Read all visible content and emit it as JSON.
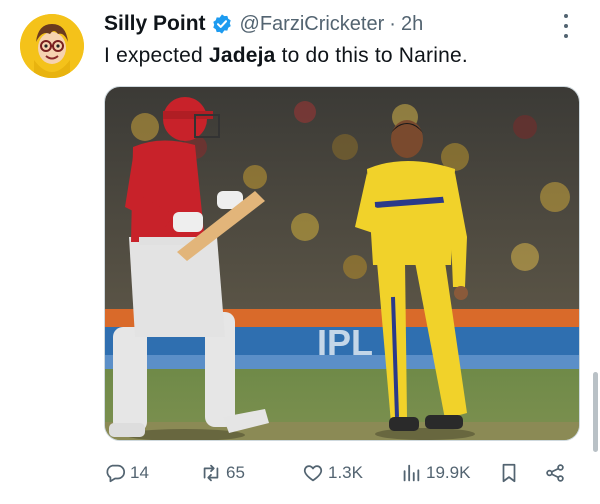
{
  "tweet": {
    "author_name": "Silly Point",
    "handle": "@FarziCricketer",
    "separator": "·",
    "time": "2h",
    "text_before": "I expected ",
    "text_bold": "Jadeja",
    "text_after": " to do this to Narine."
  },
  "media": {
    "banner_text": "IPL"
  },
  "actions": {
    "replies": "14",
    "retweets": "65",
    "likes": "1.3K",
    "views": "19.9K"
  },
  "colors": {
    "verified": "#1d9bf0",
    "secondary_text": "#536471"
  },
  "icons": [
    "verified-badge-icon",
    "more-options-icon",
    "reply-icon",
    "retweet-icon",
    "like-icon",
    "views-icon",
    "bookmark-icon",
    "share-icon"
  ]
}
